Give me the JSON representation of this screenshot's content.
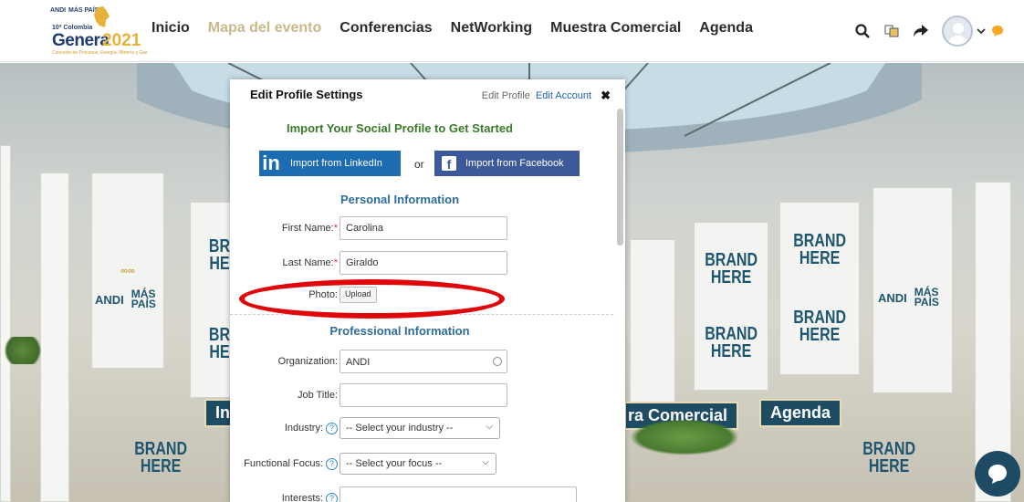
{
  "logo": {
    "top_left": "ANDI",
    "top_right": "MÁS PAÍS",
    "edition": "10ª Colombia",
    "name": "Genera",
    "year": "2021",
    "tagline": "Conexión de Procesos, Energía, Minería y Gas"
  },
  "nav": {
    "items": [
      {
        "label": "Inicio",
        "active": false
      },
      {
        "label": "Mapa del evento",
        "active": true
      },
      {
        "label": "Conferencias",
        "active": false
      },
      {
        "label": "NetWorking",
        "active": false
      },
      {
        "label": "Muestra Comercial",
        "active": false
      },
      {
        "label": "Agenda",
        "active": false
      }
    ]
  },
  "header_icons": [
    "search-icon",
    "translate-icon",
    "share-icon",
    "avatar",
    "chevron-down-icon",
    "chat-bubble-icon"
  ],
  "scene": {
    "brand_text": "BRAND\nHERE",
    "brand_partial": "BR\nHE",
    "andi": "ANDI",
    "mas_pais": "MÁS\nPAÍS",
    "sign_inicio": "Ini",
    "sign_muestra": "ra Comercial",
    "sign_agenda": "Agenda"
  },
  "modal": {
    "title": "Edit Profile Settings",
    "edit_profile": "Edit Profile",
    "edit_account": "Edit Account",
    "close_glyph": "✖",
    "import_title": "Import Your Social Profile to Get Started",
    "linkedin_label": "Import from LinkedIn",
    "or": "or",
    "facebook_label": "Import from Facebook",
    "personal_title": "Personal Information",
    "first_name_label": "First Name:",
    "first_name_value": "Carolina",
    "last_name_label": "Last Name:",
    "last_name_value": "Giraldo",
    "required_mark": "*",
    "photo_label": "Photo:",
    "upload_label": "Upload",
    "professional_title": "Professional Information",
    "organization_label": "Organization:",
    "organization_value": "ANDI",
    "job_title_label": "Job Title:",
    "job_title_value": "",
    "industry_label": "Industry:",
    "industry_value": "-- Select your industry --",
    "focus_label": "Functional Focus:",
    "focus_value": "-- Select your focus --",
    "interests_label": "Interests:",
    "help_glyph": "?"
  },
  "colors": {
    "nav_active": "#c8b98a",
    "linkedin": "#1d6bb1",
    "facebook": "#3c5a99",
    "section_blue": "#2f6d9a",
    "import_green": "#3a7a2a",
    "annotation_red": "#e0070b",
    "sign_blue": "#1e4c63"
  }
}
